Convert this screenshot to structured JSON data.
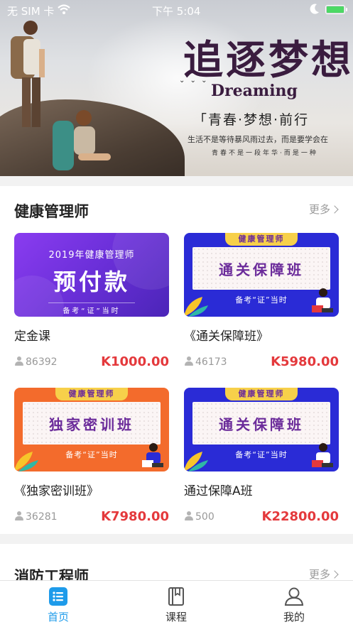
{
  "status_bar": {
    "carrier": "无 SIM 卡",
    "time": "下午 5:04"
  },
  "banner": {
    "title_cn": "追逐梦想",
    "title_en": "Dreaming",
    "slogan": "「青春·梦想·前行",
    "line1": "生活不是等待暴风雨过去，而是要学会在",
    "line2": "青春不是一段年华·而是一种"
  },
  "sections": [
    {
      "title": "健康管理师",
      "more": "更多",
      "courses": [
        {
          "title": "定金课",
          "viewers": "86392",
          "price": "K1000.00",
          "thumb": {
            "variant": "purple",
            "year": "2019年健康管理师",
            "big": "预付款",
            "tag": "备考“证”当时"
          }
        },
        {
          "title": "《通关保障班》",
          "viewers": "46173",
          "price": "K5980.00",
          "thumb": {
            "variant": "blue",
            "ribbon": "健康管理师",
            "panel": "通关保障班",
            "tag": "备考“证”当时"
          }
        },
        {
          "title": "《独家密训班》",
          "viewers": "36281",
          "price": "K7980.00",
          "thumb": {
            "variant": "orange",
            "ribbon": "健康管理师",
            "panel": "独家密训班",
            "tag": "备考“证”当时"
          }
        },
        {
          "title": "通过保障A班",
          "viewers": "500",
          "price": "K22800.00",
          "thumb": {
            "variant": "blue",
            "ribbon": "健康管理师",
            "panel": "通关保障班",
            "tag": "备考“证”当时"
          }
        }
      ]
    },
    {
      "title": "消防工程师",
      "more": "更多"
    }
  ],
  "tabbar": {
    "items": [
      {
        "label": "首页",
        "icon": "home-list-icon",
        "active": true
      },
      {
        "label": "课程",
        "icon": "book-icon",
        "active": false
      },
      {
        "label": "我的",
        "icon": "profile-icon",
        "active": false
      }
    ]
  },
  "colors": {
    "accent": "#1e9bea",
    "price": "#e4393c",
    "muted": "#999999"
  }
}
